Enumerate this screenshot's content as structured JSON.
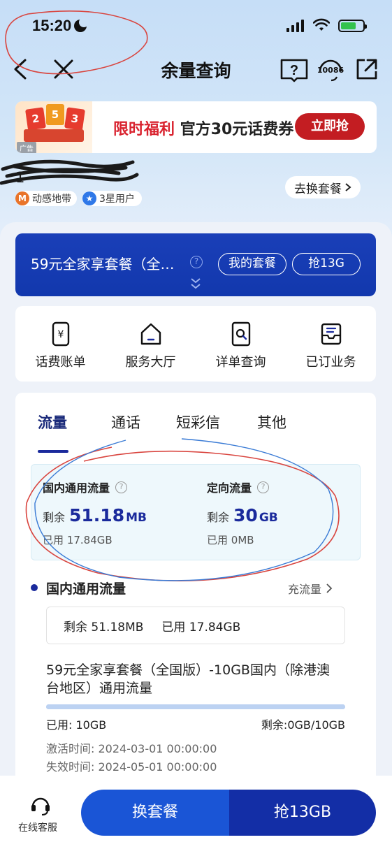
{
  "status_bar": {
    "time": "15:20"
  },
  "nav": {
    "title": "余量查询",
    "service_number": "10086"
  },
  "ad": {
    "tag": "广告",
    "highlight": "限时福利",
    "text": "官方30元话费券",
    "button": "立即抢",
    "box_labels": [
      "2",
      "5",
      "3"
    ]
  },
  "user": {
    "phone_masked": "1",
    "brand": "动感地带",
    "level": "3星用户",
    "switch_plan": "去换套餐"
  },
  "plan": {
    "name": "59元全家享套餐（全…",
    "my_plan": "我的套餐",
    "grab": "抢13G"
  },
  "menu": [
    {
      "label": "话费账单",
      "icon": "bill-icon"
    },
    {
      "label": "服务大厅",
      "icon": "home-icon"
    },
    {
      "label": "详单查询",
      "icon": "search-doc-icon"
    },
    {
      "label": "已订业务",
      "icon": "inbox-icon"
    }
  ],
  "tabs": [
    "流量",
    "通话",
    "短彩信",
    "其他"
  ],
  "usage": {
    "general": {
      "title": "国内通用流量",
      "remaining_label": "剩余",
      "remaining": "51.18",
      "unit": "MB",
      "used_label": "已用",
      "used": "17.84GB"
    },
    "directed": {
      "title": "定向流量",
      "remaining_label": "剩余",
      "remaining": "30",
      "unit": "GB",
      "used_label": "已用",
      "used": "0MB"
    }
  },
  "section": {
    "title": "国内通用流量",
    "recharge": "充流量",
    "summary_remaining": "剩余 51.18MB",
    "summary_used": "已用 17.84GB"
  },
  "package": {
    "name": "59元全家享套餐（全国版）-10GB国内（除港澳台地区）通用流量",
    "used": "已用: 10GB",
    "remaining": "剩余:0GB/10GB",
    "used_fraction": 1.0,
    "activated": "激活时间: 2024-03-01 00:00:00",
    "expires": "失效时间: 2024-05-01 00:00:00"
  },
  "bottom": {
    "service": "在线客服",
    "change_plan": "换套餐",
    "grab": "抢13GB"
  },
  "colors": {
    "primary": "#1a2a9c",
    "plan_bg": "#1a3fb8",
    "ad_red": "#c31d22",
    "button_light": "#1a55d6"
  }
}
